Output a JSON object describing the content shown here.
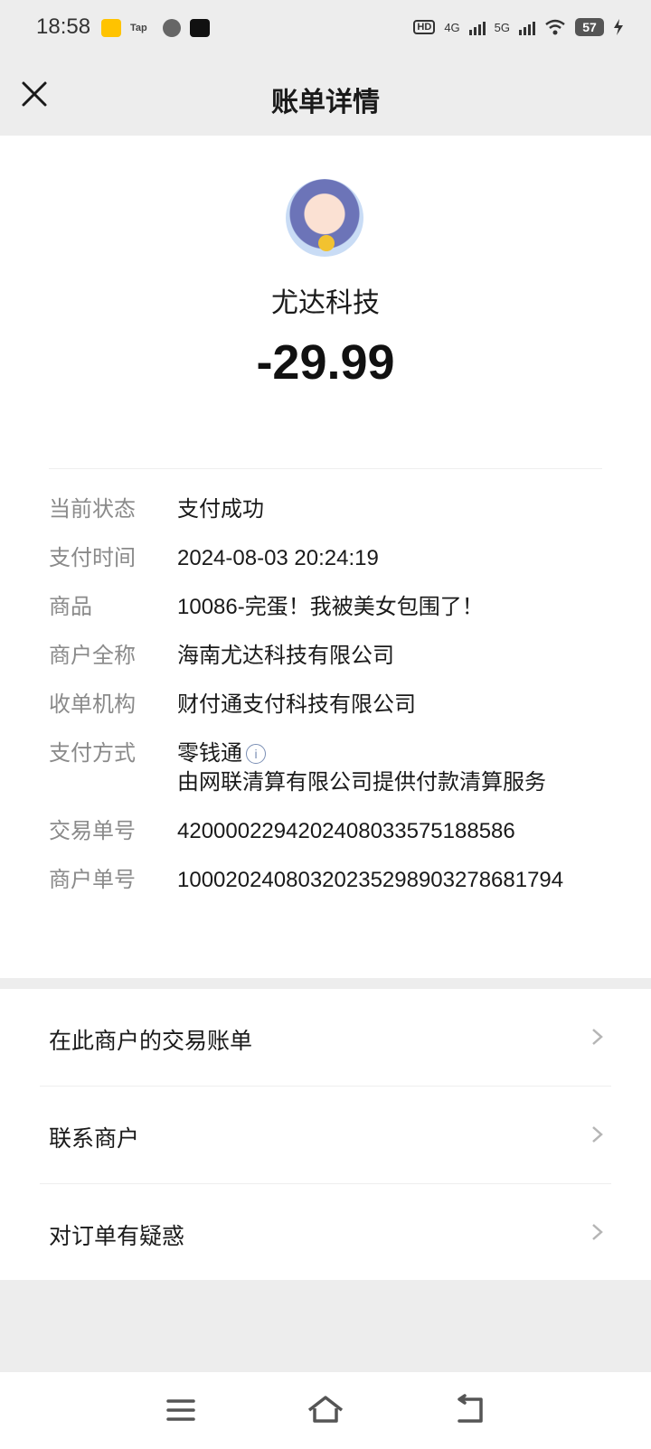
{
  "status_bar": {
    "time": "18:58",
    "app_icons": [
      "meituan-icon",
      "tap-icon",
      "message-icon",
      "tiktok-icon"
    ],
    "tap_label": "Tap",
    "network_labels": [
      "HD",
      "4G",
      "5G"
    ],
    "battery": "57"
  },
  "nav": {
    "title": "账单详情",
    "close_icon": "close-icon"
  },
  "bill": {
    "merchant_name": "尤达科技",
    "amount": "-29.99",
    "details": [
      {
        "label": "当前状态",
        "value": "支付成功"
      },
      {
        "label": "支付时间",
        "value": "2024-08-03 20:24:19"
      },
      {
        "label": "商品",
        "value": "10086-完蛋！我被美女包围了！"
      },
      {
        "label": "商户全称",
        "value": "海南尤达科技有限公司"
      },
      {
        "label": "收单机构",
        "value": "财付通支付科技有限公司"
      },
      {
        "label": "支付方式",
        "value": "零钱通",
        "sub_value": "由网联清算有限公司提供付款清算服务"
      },
      {
        "label": "交易单号",
        "value": "4200002294202408033575188586"
      },
      {
        "label": "商户单号",
        "value": "10002024080320235298903278681794"
      }
    ]
  },
  "links": [
    {
      "label": "在此商户的交易账单"
    },
    {
      "label": "联系商户"
    },
    {
      "label": "对订单有疑惑"
    }
  ],
  "bottom_nav": [
    "menu-icon",
    "home-icon",
    "back-icon"
  ],
  "colors": {
    "background": "#ededed",
    "card": "#ffffff",
    "label_gray": "#8a8a8a",
    "text": "#1a1a1a"
  }
}
